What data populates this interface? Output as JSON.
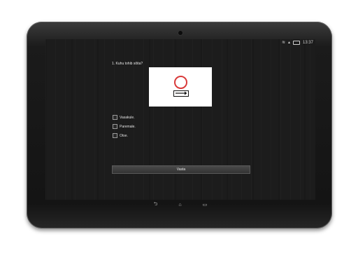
{
  "status_bar": {
    "time": "13:37",
    "wifi_icon": "wifi-icon",
    "signal_icon": "signal-icon",
    "battery_icon": "battery-icon"
  },
  "quiz": {
    "question": "1. Kuhu tohib sõita?",
    "options": [
      "Vasakule.",
      "Paremale.",
      "Otse."
    ],
    "answer_button": "Vasta",
    "sign_colors": {
      "ring": "#d93a3a",
      "arrow": "#111111"
    }
  },
  "navigation": {
    "back_icon": "back-icon",
    "home_icon": "home-icon",
    "recents_icon": "recents-icon"
  }
}
